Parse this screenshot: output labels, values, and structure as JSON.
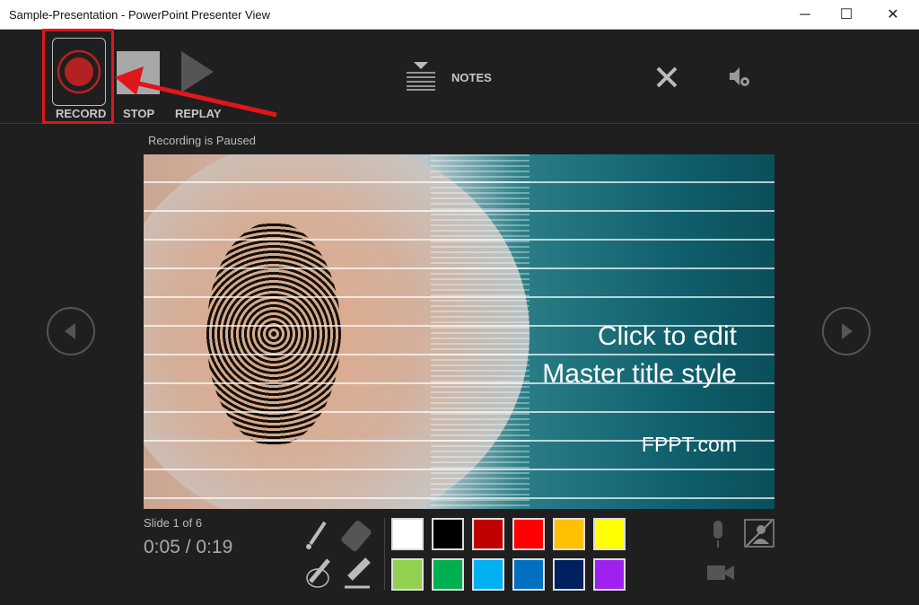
{
  "window": {
    "title": "Sample-Presentation - PowerPoint Presenter View",
    "minimize": "─",
    "maximize": "☐",
    "close": "✕"
  },
  "toolbar": {
    "record": "RECORD",
    "stop": "STOP",
    "replay": "REPLAY",
    "notes": "NOTES"
  },
  "status": "Recording is Paused",
  "slide": {
    "title_line1": "Click to edit",
    "title_line2": "Master title style",
    "brand": "FPPT.com"
  },
  "footer": {
    "slide_counter": "Slide 1 of 6",
    "elapsed": "0:05",
    "separator": "/",
    "total": "0:19"
  },
  "colors": [
    "#ffffff",
    "#000000",
    "#c00000",
    "#ff0000",
    "#ffc000",
    "#ffff00",
    "#92d050",
    "#00b050",
    "#00b0f0",
    "#0070c0",
    "#002060",
    "#a020f0"
  ],
  "accent": "#e0161b"
}
